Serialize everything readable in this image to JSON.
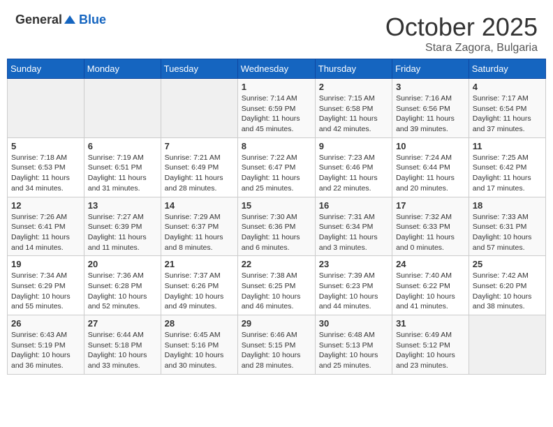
{
  "header": {
    "logo_general": "General",
    "logo_blue": "Blue",
    "month": "October 2025",
    "location": "Stara Zagora, Bulgaria"
  },
  "weekdays": [
    "Sunday",
    "Monday",
    "Tuesday",
    "Wednesday",
    "Thursday",
    "Friday",
    "Saturday"
  ],
  "weeks": [
    [
      {
        "day": "",
        "sunrise": "",
        "sunset": "",
        "daylight": ""
      },
      {
        "day": "",
        "sunrise": "",
        "sunset": "",
        "daylight": ""
      },
      {
        "day": "",
        "sunrise": "",
        "sunset": "",
        "daylight": ""
      },
      {
        "day": "1",
        "sunrise": "Sunrise: 7:14 AM",
        "sunset": "Sunset: 6:59 PM",
        "daylight": "Daylight: 11 hours and 45 minutes."
      },
      {
        "day": "2",
        "sunrise": "Sunrise: 7:15 AM",
        "sunset": "Sunset: 6:58 PM",
        "daylight": "Daylight: 11 hours and 42 minutes."
      },
      {
        "day": "3",
        "sunrise": "Sunrise: 7:16 AM",
        "sunset": "Sunset: 6:56 PM",
        "daylight": "Daylight: 11 hours and 39 minutes."
      },
      {
        "day": "4",
        "sunrise": "Sunrise: 7:17 AM",
        "sunset": "Sunset: 6:54 PM",
        "daylight": "Daylight: 11 hours and 37 minutes."
      }
    ],
    [
      {
        "day": "5",
        "sunrise": "Sunrise: 7:18 AM",
        "sunset": "Sunset: 6:53 PM",
        "daylight": "Daylight: 11 hours and 34 minutes."
      },
      {
        "day": "6",
        "sunrise": "Sunrise: 7:19 AM",
        "sunset": "Sunset: 6:51 PM",
        "daylight": "Daylight: 11 hours and 31 minutes."
      },
      {
        "day": "7",
        "sunrise": "Sunrise: 7:21 AM",
        "sunset": "Sunset: 6:49 PM",
        "daylight": "Daylight: 11 hours and 28 minutes."
      },
      {
        "day": "8",
        "sunrise": "Sunrise: 7:22 AM",
        "sunset": "Sunset: 6:47 PM",
        "daylight": "Daylight: 11 hours and 25 minutes."
      },
      {
        "day": "9",
        "sunrise": "Sunrise: 7:23 AM",
        "sunset": "Sunset: 6:46 PM",
        "daylight": "Daylight: 11 hours and 22 minutes."
      },
      {
        "day": "10",
        "sunrise": "Sunrise: 7:24 AM",
        "sunset": "Sunset: 6:44 PM",
        "daylight": "Daylight: 11 hours and 20 minutes."
      },
      {
        "day": "11",
        "sunrise": "Sunrise: 7:25 AM",
        "sunset": "Sunset: 6:42 PM",
        "daylight": "Daylight: 11 hours and 17 minutes."
      }
    ],
    [
      {
        "day": "12",
        "sunrise": "Sunrise: 7:26 AM",
        "sunset": "Sunset: 6:41 PM",
        "daylight": "Daylight: 11 hours and 14 minutes."
      },
      {
        "day": "13",
        "sunrise": "Sunrise: 7:27 AM",
        "sunset": "Sunset: 6:39 PM",
        "daylight": "Daylight: 11 hours and 11 minutes."
      },
      {
        "day": "14",
        "sunrise": "Sunrise: 7:29 AM",
        "sunset": "Sunset: 6:37 PM",
        "daylight": "Daylight: 11 hours and 8 minutes."
      },
      {
        "day": "15",
        "sunrise": "Sunrise: 7:30 AM",
        "sunset": "Sunset: 6:36 PM",
        "daylight": "Daylight: 11 hours and 6 minutes."
      },
      {
        "day": "16",
        "sunrise": "Sunrise: 7:31 AM",
        "sunset": "Sunset: 6:34 PM",
        "daylight": "Daylight: 11 hours and 3 minutes."
      },
      {
        "day": "17",
        "sunrise": "Sunrise: 7:32 AM",
        "sunset": "Sunset: 6:33 PM",
        "daylight": "Daylight: 11 hours and 0 minutes."
      },
      {
        "day": "18",
        "sunrise": "Sunrise: 7:33 AM",
        "sunset": "Sunset: 6:31 PM",
        "daylight": "Daylight: 10 hours and 57 minutes."
      }
    ],
    [
      {
        "day": "19",
        "sunrise": "Sunrise: 7:34 AM",
        "sunset": "Sunset: 6:29 PM",
        "daylight": "Daylight: 10 hours and 55 minutes."
      },
      {
        "day": "20",
        "sunrise": "Sunrise: 7:36 AM",
        "sunset": "Sunset: 6:28 PM",
        "daylight": "Daylight: 10 hours and 52 minutes."
      },
      {
        "day": "21",
        "sunrise": "Sunrise: 7:37 AM",
        "sunset": "Sunset: 6:26 PM",
        "daylight": "Daylight: 10 hours and 49 minutes."
      },
      {
        "day": "22",
        "sunrise": "Sunrise: 7:38 AM",
        "sunset": "Sunset: 6:25 PM",
        "daylight": "Daylight: 10 hours and 46 minutes."
      },
      {
        "day": "23",
        "sunrise": "Sunrise: 7:39 AM",
        "sunset": "Sunset: 6:23 PM",
        "daylight": "Daylight: 10 hours and 44 minutes."
      },
      {
        "day": "24",
        "sunrise": "Sunrise: 7:40 AM",
        "sunset": "Sunset: 6:22 PM",
        "daylight": "Daylight: 10 hours and 41 minutes."
      },
      {
        "day": "25",
        "sunrise": "Sunrise: 7:42 AM",
        "sunset": "Sunset: 6:20 PM",
        "daylight": "Daylight: 10 hours and 38 minutes."
      }
    ],
    [
      {
        "day": "26",
        "sunrise": "Sunrise: 6:43 AM",
        "sunset": "Sunset: 5:19 PM",
        "daylight": "Daylight: 10 hours and 36 minutes."
      },
      {
        "day": "27",
        "sunrise": "Sunrise: 6:44 AM",
        "sunset": "Sunset: 5:18 PM",
        "daylight": "Daylight: 10 hours and 33 minutes."
      },
      {
        "day": "28",
        "sunrise": "Sunrise: 6:45 AM",
        "sunset": "Sunset: 5:16 PM",
        "daylight": "Daylight: 10 hours and 30 minutes."
      },
      {
        "day": "29",
        "sunrise": "Sunrise: 6:46 AM",
        "sunset": "Sunset: 5:15 PM",
        "daylight": "Daylight: 10 hours and 28 minutes."
      },
      {
        "day": "30",
        "sunrise": "Sunrise: 6:48 AM",
        "sunset": "Sunset: 5:13 PM",
        "daylight": "Daylight: 10 hours and 25 minutes."
      },
      {
        "day": "31",
        "sunrise": "Sunrise: 6:49 AM",
        "sunset": "Sunset: 5:12 PM",
        "daylight": "Daylight: 10 hours and 23 minutes."
      },
      {
        "day": "",
        "sunrise": "",
        "sunset": "",
        "daylight": ""
      }
    ]
  ]
}
